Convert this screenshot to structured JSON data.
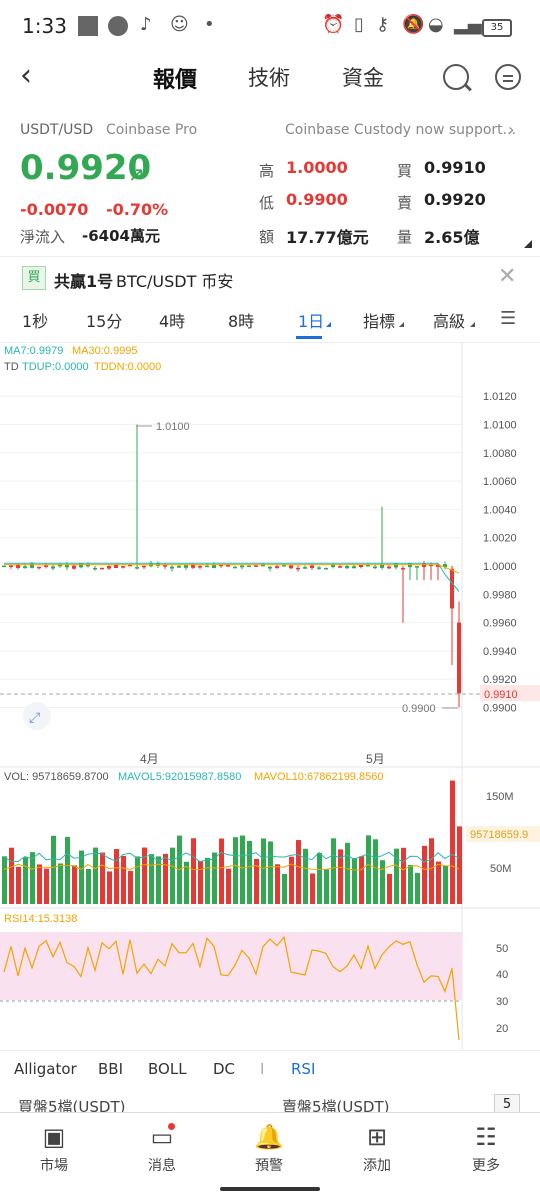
{
  "status": {
    "time": "1:33",
    "battery": "35"
  },
  "nav": {
    "tabs": [
      {
        "label": "報價"
      },
      {
        "label": "技術"
      },
      {
        "label": "資金"
      }
    ]
  },
  "ticker": {
    "pair": "USDT/USD",
    "exchange": "Coinbase Pro",
    "news": "Coinbase Custody now support...",
    "price": "0.9920",
    "change": "-0.0070",
    "change_pct": "-0.70%",
    "netflow_label": "淨流入",
    "netflow_value": "-6404萬元"
  },
  "stats": {
    "high_label": "高",
    "high": "1.0000",
    "low_label": "低",
    "low": "0.9900",
    "amount_label": "額",
    "amount": "17.77億元",
    "buy_label": "買",
    "buy": "0.9910",
    "sell_label": "賣",
    "sell": "0.9920",
    "volume_label": "量",
    "volume": "2.65億"
  },
  "banner": {
    "badge": "買",
    "text_bold": "共贏1号",
    "text": "BTC/USDT 币安"
  },
  "timeframes": [
    {
      "label": "1秒"
    },
    {
      "label": "15分"
    },
    {
      "label": "4時"
    },
    {
      "label": "8時"
    },
    {
      "label": "1日"
    },
    {
      "label": "指標"
    },
    {
      "label": "高級"
    }
  ],
  "chart": {
    "ma_legend": {
      "ma7": "MA7:0.9979",
      "ma30": "MA30:0.9995"
    },
    "td_legend": {
      "td": "TD",
      "tdup": "TDUP:0.0000",
      "tddn": "TDDN:0.0000"
    },
    "price_ticks": [
      "1.0120",
      "1.0100",
      "1.0080",
      "1.0060",
      "1.0040",
      "1.0020",
      "1.0000",
      "0.9980",
      "0.9960",
      "0.9940",
      "0.9920",
      "0.9900"
    ],
    "high_annotation": "1.0100",
    "low_annotation": "0.9900",
    "last_price_tag": "0.9910",
    "x_ticks": [
      "4月",
      "5月"
    ],
    "vol_legend": {
      "vol": "VOL: 95718659.8700",
      "mavol5": "MAVOL5:92015987.8580",
      "mavol10": "MAVOL10:67862199.8560"
    },
    "vol_ticks": [
      "150M",
      "50M"
    ],
    "vol_tag": "95718659.9",
    "rsi_legend": "RSI14:15.3138",
    "rsi_ticks": [
      "50",
      "40",
      "30",
      "20"
    ],
    "colors": {
      "up": "#33a853",
      "down": "#e53935",
      "ma7": "#29b6b0",
      "ma30": "#f0a500",
      "rsi": "#f0a500",
      "rsi_band": "#f9e1f0"
    }
  },
  "indicators": [
    {
      "label": "Alligator"
    },
    {
      "label": "BBI"
    },
    {
      "label": "BOLL"
    },
    {
      "label": "DC"
    },
    {
      "label": "I"
    },
    {
      "label": "RSI"
    }
  ],
  "orderbook": {
    "buy": "買盤5檔(USDT)",
    "sell": "賣盤5檔(USDT)",
    "depth": "5"
  },
  "bottom_nav": [
    {
      "label": "市場"
    },
    {
      "label": "消息"
    },
    {
      "label": "預警"
    },
    {
      "label": "添加"
    },
    {
      "label": "更多"
    }
  ]
}
